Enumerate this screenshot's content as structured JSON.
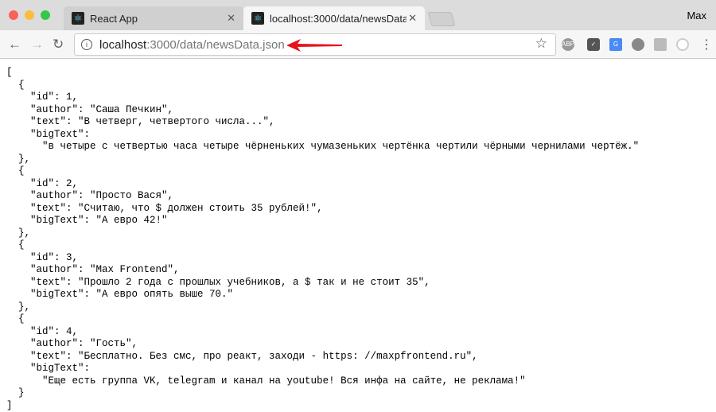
{
  "window": {
    "user": "Max"
  },
  "tabs": [
    {
      "title": "React App",
      "icon": "react-icon"
    },
    {
      "title": "localhost:3000/data/newsData",
      "icon": "react-icon",
      "active": true
    }
  ],
  "address": {
    "host": "localhost",
    "path": ":3000/data/newsData.json"
  },
  "extensions": [
    "abp-icon",
    "pocket-icon",
    "google-translate-icon",
    "extension-icon",
    "drive-icon",
    "circle-extension-icon"
  ],
  "annotation": {
    "arrow_color": "#e8121a"
  },
  "json_lines": [
    "[",
    "  {",
    "    \"id\": 1,",
    "    \"author\": \"Саша Печкин\",",
    "    \"text\": \"В четверг, четвертого числа...\",",
    "    \"bigText\":",
    "      \"в четыре с четвертью часа четыре чёрненьких чумазеньких чертёнка чертили чёрными чернилами чертёж.\"",
    "  },",
    "  {",
    "    \"id\": 2,",
    "    \"author\": \"Просто Вася\",",
    "    \"text\": \"Считаю, что $ должен стоить 35 рублей!\",",
    "    \"bigText\": \"А евро 42!\"",
    "  },",
    "  {",
    "    \"id\": 3,",
    "    \"author\": \"Max Frontend\",",
    "    \"text\": \"Прошло 2 года с прошлых учебников, а $ так и не стоит 35\",",
    "    \"bigText\": \"А евро опять выше 70.\"",
    "  },",
    "  {",
    "    \"id\": 4,",
    "    \"author\": \"Гость\",",
    "    \"text\": \"Бесплатно. Без смс, про реакт, заходи - https: //maxpfrontend.ru\",",
    "    \"bigText\":",
    "      \"Еще есть группа VK, telegram и канал на youtube! Вся инфа на сайте, не реклама!\"",
    "  }",
    "]"
  ]
}
